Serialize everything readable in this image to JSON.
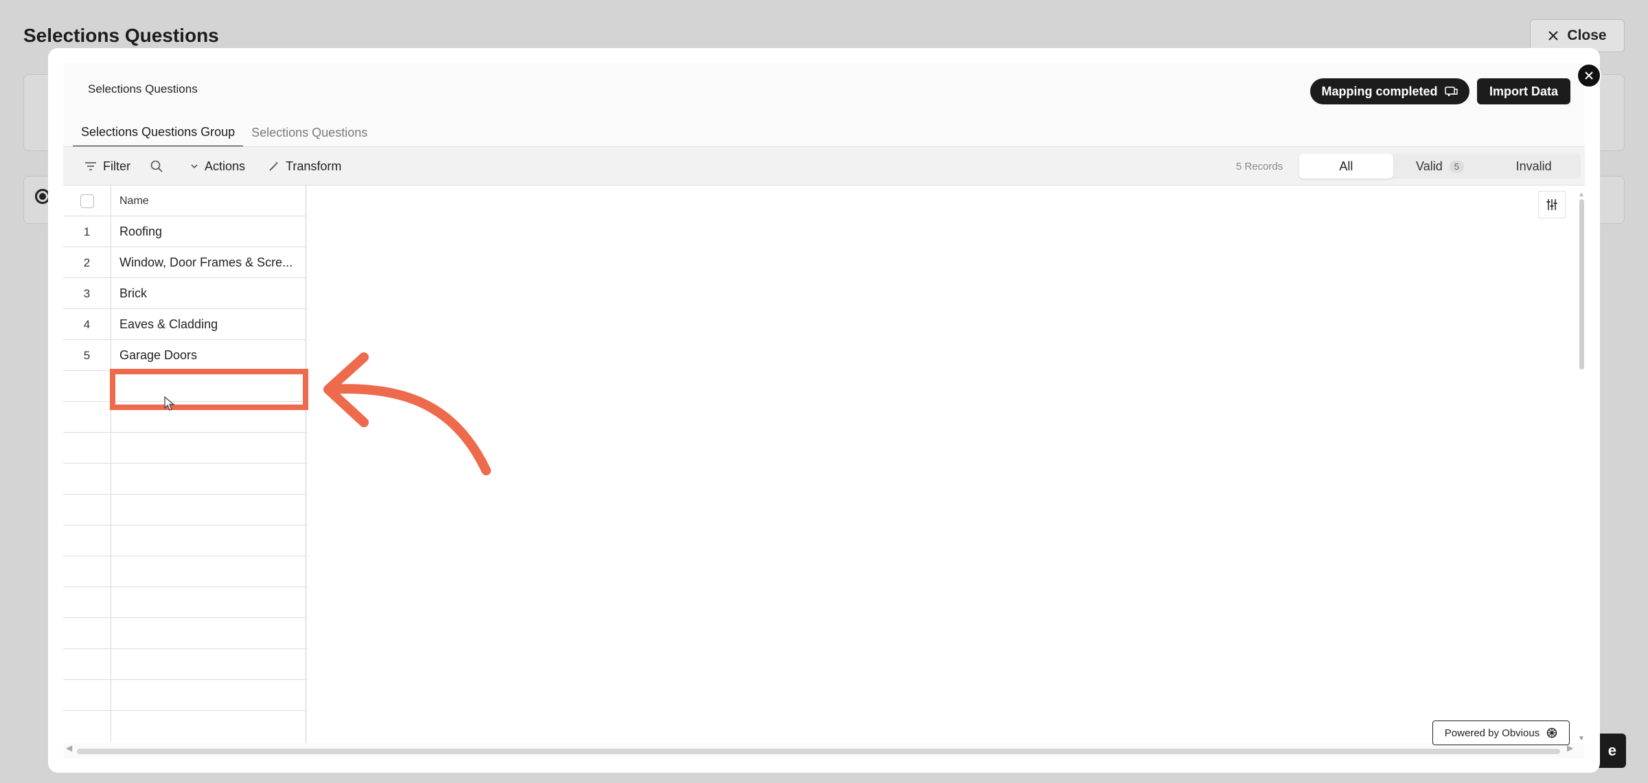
{
  "background": {
    "title": "Selections Questions",
    "close_label": "Close",
    "dark_button_label": "e"
  },
  "modal": {
    "title": "Selections Questions",
    "mapping_label": "Mapping completed",
    "import_label": "Import Data",
    "tabs": [
      {
        "label": "Selections Questions Group",
        "active": true
      },
      {
        "label": "Selections Questions",
        "active": false
      }
    ],
    "toolbar": {
      "filter_label": "Filter",
      "actions_label": "Actions",
      "transform_label": "Transform",
      "records_text": "5 Records",
      "segments": [
        {
          "label": "All",
          "active": true
        },
        {
          "label": "Valid",
          "count": "5",
          "active": false
        },
        {
          "label": "Invalid",
          "active": false
        }
      ]
    },
    "grid": {
      "header_name": "Name",
      "rows": [
        {
          "num": "1",
          "name": "Roofing"
        },
        {
          "num": "2",
          "name": "Window, Door Frames & Scre..."
        },
        {
          "num": "3",
          "name": "Brick"
        },
        {
          "num": "4",
          "name": "Eaves & Cladding"
        },
        {
          "num": "5",
          "name": "Garage Doors"
        }
      ],
      "add_row_symbol": "+"
    },
    "powered_by": "Powered by Obvious"
  },
  "colors": {
    "annotation": "#ee6a4c",
    "button_dark": "#1c1c1c"
  }
}
